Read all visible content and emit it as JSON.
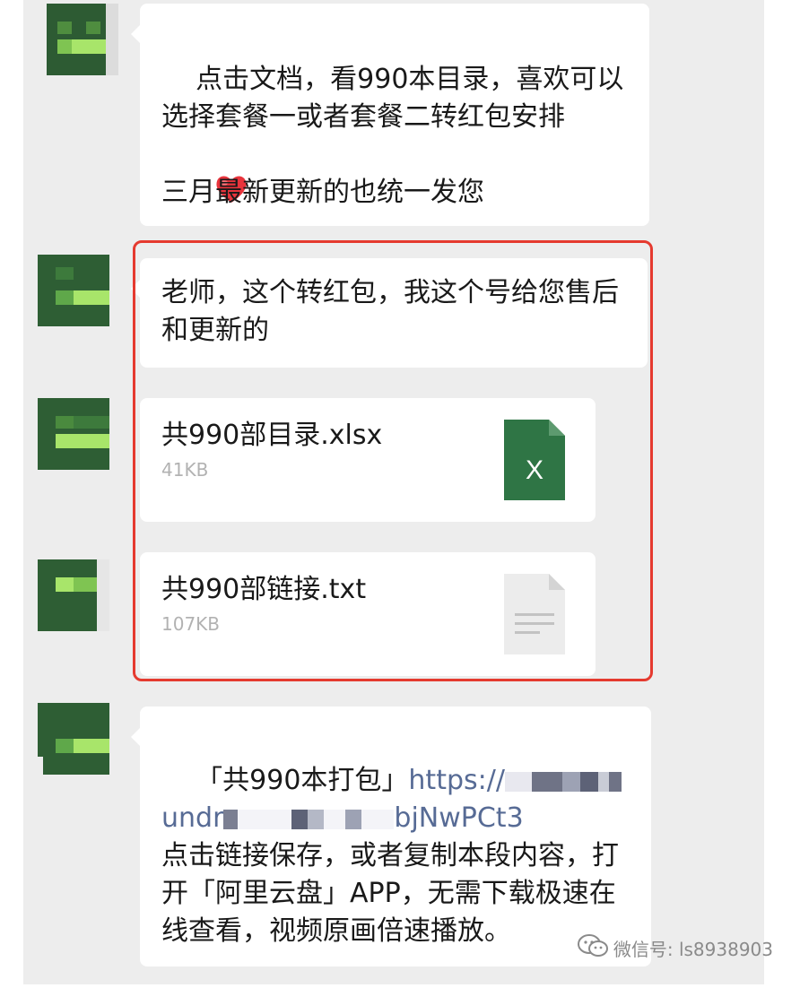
{
  "messages": {
    "m1": {
      "text": "点击文档，看990本目录，喜欢可以选择套餐一或者套餐二转红包安排",
      "emoji": "heart-emoji",
      "text2": "三月最新更新的也统一发您"
    },
    "m2": {
      "text": "老师，这个转红包，我这个号给您售后和更新的"
    },
    "m3": {
      "file_name": "共990部目录.xlsx",
      "file_size": "41KB",
      "icon": "excel-file-icon",
      "icon_color": "#2f7545",
      "icon_letter": "X"
    },
    "m4": {
      "file_name": "共990部链接.txt",
      "file_size": "107KB",
      "icon": "text-file-icon",
      "icon_color": "#ececec"
    },
    "m5": {
      "prefix": "「共990本打包」",
      "link_start": "https://",
      "link_mid": "undr",
      "link_end": "bjNwPCt3",
      "text": "点击链接保存，或者复制本段内容，打开「阿里云盘」APP，无需下载极速在线查看，视频原画倍速播放。"
    }
  },
  "watermark": {
    "label": "微信号: ls8938903",
    "icon": "wechat-icon"
  },
  "colors": {
    "highlight": "#e53a2f",
    "link": "#576b95",
    "chat_bg": "#ededed",
    "avatar": "#2e5e34"
  }
}
